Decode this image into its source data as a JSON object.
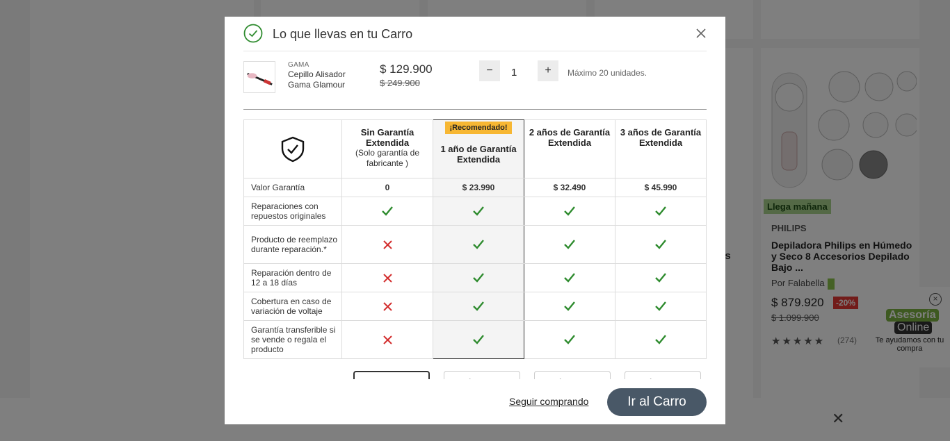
{
  "modal": {
    "title": "Lo que llevas en tu Carro",
    "product": {
      "brand": "GAMA",
      "name": "Cepillo Alisador Gama Glamour",
      "price": "$ 129.900",
      "old_price": "$ 249.900",
      "quantity": "1",
      "qty_minus": "−",
      "qty_plus": "+",
      "max_note": "Máximo 20 unidades."
    },
    "warranty": {
      "columns": [
        {
          "title": "Sin Garantía Extendida",
          "subtitle": "(Solo garantía de fabricante )",
          "value": "0"
        },
        {
          "badge": "¡Recomendado!",
          "title": "1 año de Garantía Extendida",
          "value": "$ 23.990"
        },
        {
          "title": "2 años de Garantía Extendida",
          "value": "$ 32.490"
        },
        {
          "title": "3 años de Garantía Extendida",
          "value": "$ 45.990"
        }
      ],
      "value_label": "Valor Garantía",
      "features": [
        {
          "label": "Reparaciones con repuestos originales",
          "marks": [
            "check",
            "check",
            "check",
            "check"
          ]
        },
        {
          "label": "Producto de reemplazo durante reparación.*",
          "marks": [
            "cross",
            "check",
            "check",
            "check"
          ]
        },
        {
          "label": "Reparación dentro de 12 a 18 días",
          "marks": [
            "cross",
            "check",
            "check",
            "check"
          ]
        },
        {
          "label": "Cobertura en caso de variación de voltaje",
          "marks": [
            "cross",
            "check",
            "check",
            "check"
          ]
        },
        {
          "label": "Garantía transferible si se vende o regala el producto",
          "marks": [
            "cross",
            "check",
            "check",
            "check"
          ]
        }
      ],
      "select_buttons": [
        "",
        "Agregar",
        "Agregar",
        "Agregar"
      ]
    },
    "footer": {
      "continue_label": "Seguir comprando",
      "cart_label": "Ir al Carro"
    }
  },
  "background": {
    "badge": "Llega mañana",
    "brand": "PHILIPS",
    "product_name": "Depiladora Philips en Húmedo y Seco 8 Accesorios Depilado Bajo ...",
    "seller": "Por Falabella",
    "price": "$ 879.920",
    "discount": "-20%",
    "old_price": "$ 1.099.900",
    "reviews": "(274)",
    "partial_text": "es",
    "chat": {
      "line1": "Asesoría",
      "line2": "Online",
      "text": "Te ayudamos con tu compra"
    }
  },
  "colors": {
    "check": "#2e8b2e",
    "cross": "#d32f2f",
    "cart_button": "#495867",
    "badge": "#f7b733"
  }
}
